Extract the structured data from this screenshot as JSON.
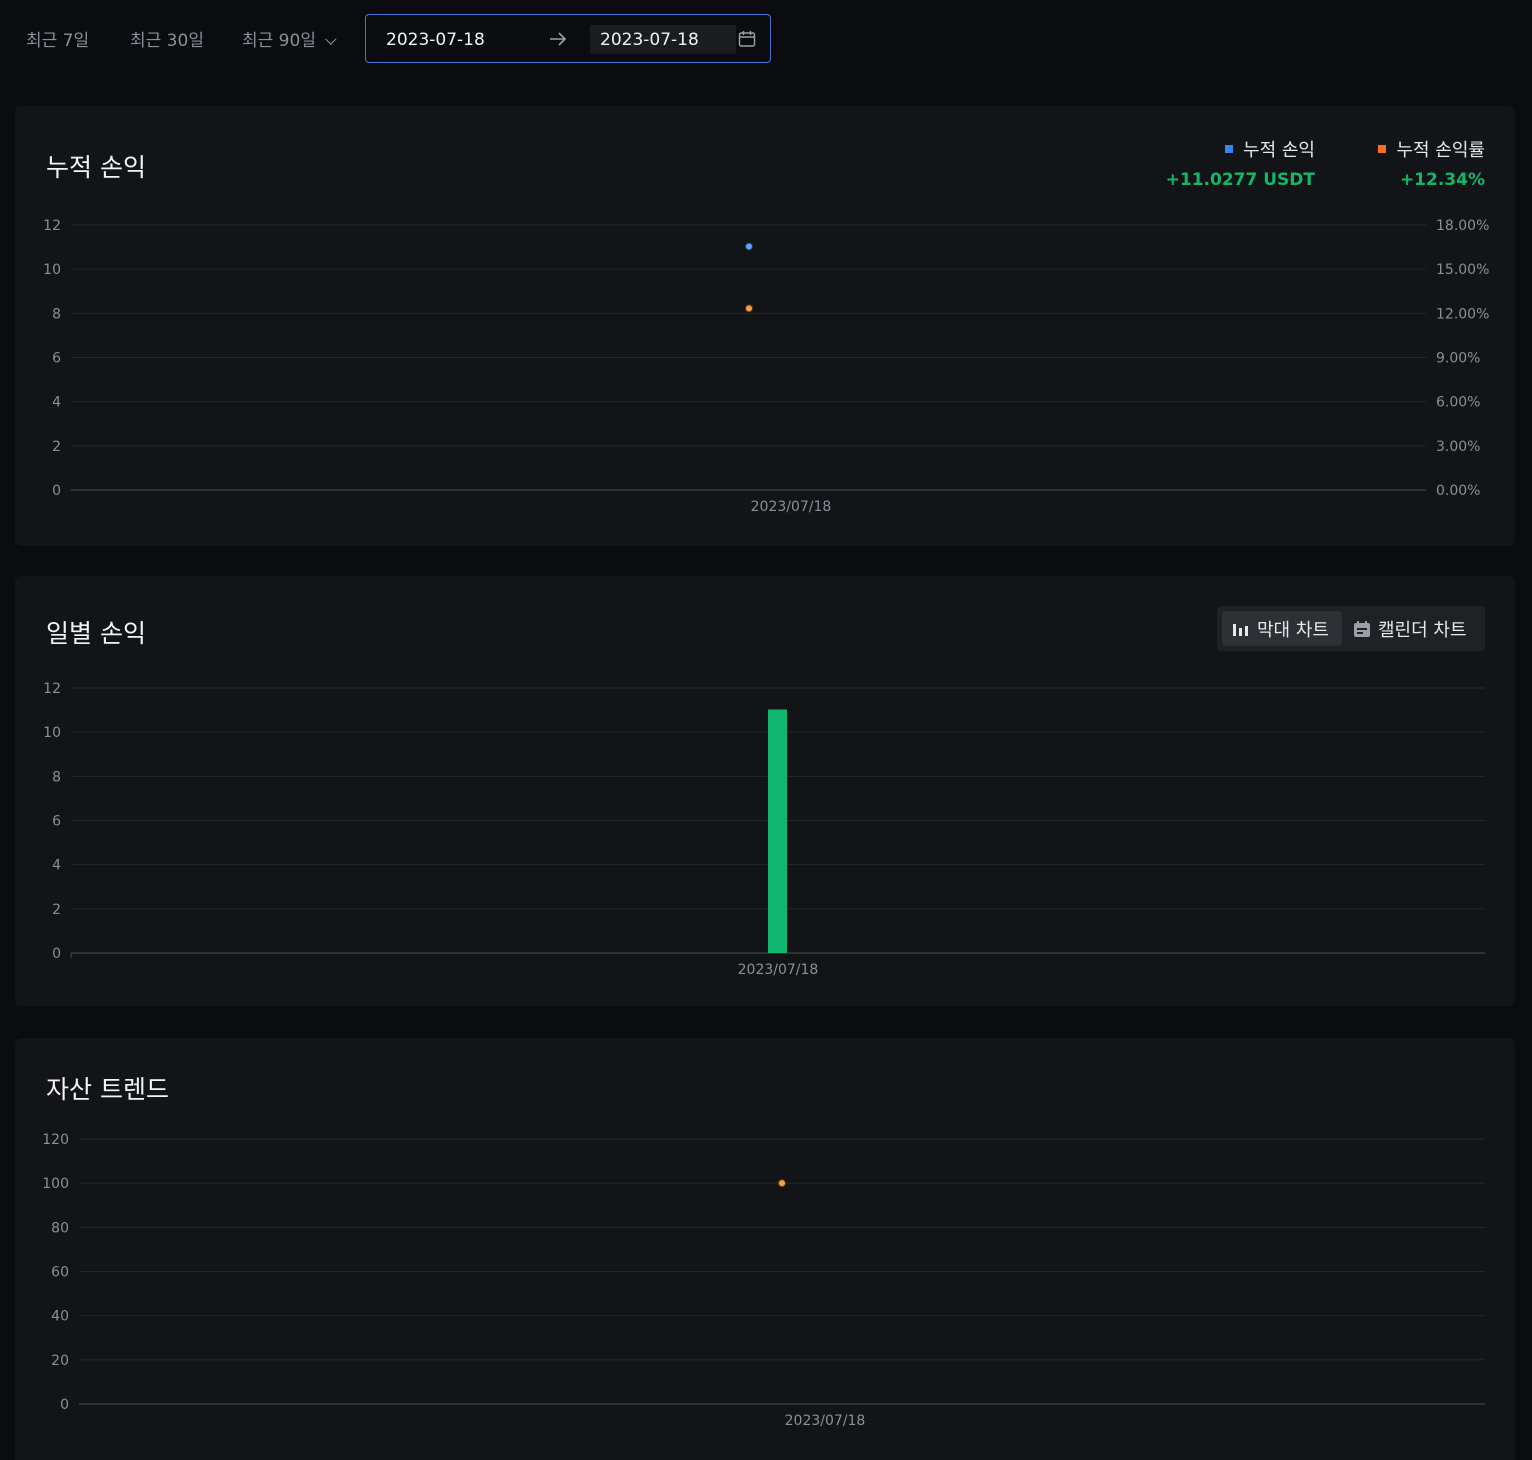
{
  "filters": {
    "ranges": [
      {
        "label": "최근 7일"
      },
      {
        "label": "최근 30일"
      },
      {
        "label": "최근 90일"
      }
    ],
    "start_date": "2023-07-18",
    "end_date": "2023-07-18"
  },
  "cumulative": {
    "title": "누적 손익",
    "legend": [
      {
        "name": "누적 손익",
        "value": "+11.0277 USDT",
        "color": "#3b82f6"
      },
      {
        "name": "누적 손익률",
        "value": "+12.34%",
        "color": "#f97316"
      }
    ]
  },
  "daily": {
    "title": "일별 손익",
    "toggle": {
      "bar_label": "막대 차트",
      "calendar_label": "캘린더 차트"
    }
  },
  "asset": {
    "title": "자산 트렌드"
  },
  "chart_data": [
    {
      "type": "scatter",
      "title": "누적 손익",
      "x": [
        "2023/07/18"
      ],
      "series": [
        {
          "name": "누적 손익",
          "axis": "left",
          "values": [
            11.0277
          ],
          "color": "#3b82f6"
        },
        {
          "name": "누적 손익률",
          "axis": "right",
          "values": [
            12.34
          ],
          "color": "#f97316"
        }
      ],
      "yticks_left": [
        "0",
        "2",
        "4",
        "6",
        "8",
        "10",
        "12"
      ],
      "yticks_right": [
        "0.00%",
        "3.00%",
        "6.00%",
        "9.00%",
        "12.00%",
        "15.00%",
        "18.00%"
      ],
      "ylim_left": [
        0,
        12
      ],
      "ylim_right": [
        0,
        18
      ],
      "grid": true
    },
    {
      "type": "bar",
      "title": "일별 손익",
      "categories": [
        "2023/07/18"
      ],
      "values": [
        11.0277
      ],
      "color": "#10b670",
      "yticks": [
        "0",
        "2",
        "4",
        "6",
        "8",
        "10",
        "12"
      ],
      "ylim": [
        0,
        12
      ],
      "grid": true
    },
    {
      "type": "scatter",
      "title": "자산 트렌드",
      "x": [
        "2023/07/18"
      ],
      "series": [
        {
          "values": [
            100
          ],
          "color": "#f5a142"
        }
      ],
      "yticks": [
        "0",
        "20",
        "40",
        "60",
        "80",
        "100",
        "120"
      ],
      "ylim": [
        0,
        120
      ],
      "grid": true
    }
  ]
}
